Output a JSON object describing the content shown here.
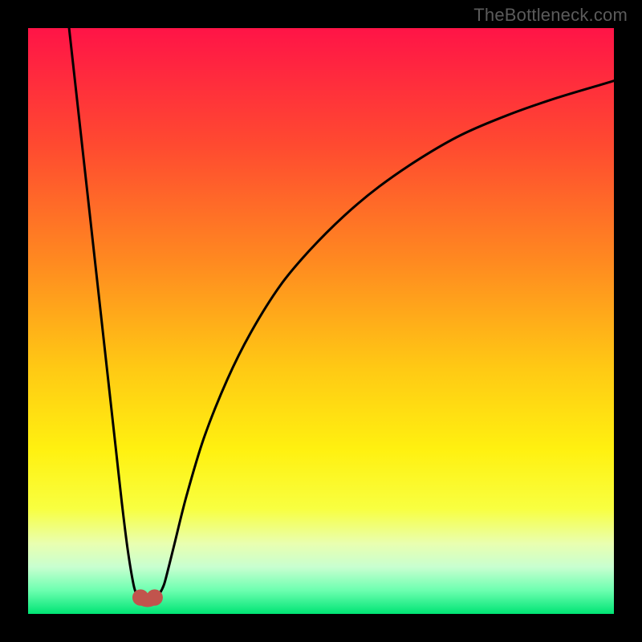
{
  "watermark": "TheBottleneck.com",
  "chart_data": {
    "type": "line",
    "title": "",
    "xlabel": "",
    "ylabel": "",
    "xlim": [
      0,
      100
    ],
    "ylim": [
      0,
      100
    ],
    "grid": false,
    "legend": false,
    "annotations": [],
    "background_gradient_stops": [
      {
        "offset": 0.0,
        "color": "#ff1447"
      },
      {
        "offset": 0.2,
        "color": "#ff4a30"
      },
      {
        "offset": 0.4,
        "color": "#ff8a20"
      },
      {
        "offset": 0.58,
        "color": "#ffc914"
      },
      {
        "offset": 0.72,
        "color": "#fff110"
      },
      {
        "offset": 0.82,
        "color": "#f8ff40"
      },
      {
        "offset": 0.88,
        "color": "#e9ffb0"
      },
      {
        "offset": 0.92,
        "color": "#c8ffd0"
      },
      {
        "offset": 0.96,
        "color": "#6cffb0"
      },
      {
        "offset": 1.0,
        "color": "#00e474"
      }
    ],
    "series": [
      {
        "name": "bottleneck-curve",
        "x": [
          7,
          8,
          9,
          10,
          11,
          12,
          13,
          14,
          15,
          16,
          17,
          18,
          18.6,
          19.2,
          19.8,
          20.2,
          21.6,
          22.4,
          23.2,
          24,
          25,
          27,
          30,
          34,
          38,
          43,
          48,
          54,
          60,
          67,
          74,
          82,
          90,
          98,
          100
        ],
        "y": [
          100,
          91,
          82,
          73,
          64,
          55,
          46,
          37,
          28,
          19,
          11,
          5,
          3.2,
          2.6,
          2.4,
          2.4,
          2.6,
          3.4,
          5,
          8,
          12,
          20,
          30,
          40,
          48,
          56,
          62,
          68,
          73,
          77.8,
          81.8,
          85.2,
          88,
          90.4,
          91
        ]
      }
    ],
    "markers": [
      {
        "name": "min-marker-left",
        "x": 19.2,
        "y": 2.8,
        "r": 1.4,
        "color": "#c1544d"
      },
      {
        "name": "min-marker-right",
        "x": 21.6,
        "y": 2.8,
        "r": 1.4,
        "color": "#c1544d"
      }
    ],
    "min_bridge": {
      "x1": 19.2,
      "x2": 21.6,
      "y": 2.5,
      "stroke_width": 1.8,
      "color": "#c1544d"
    }
  }
}
